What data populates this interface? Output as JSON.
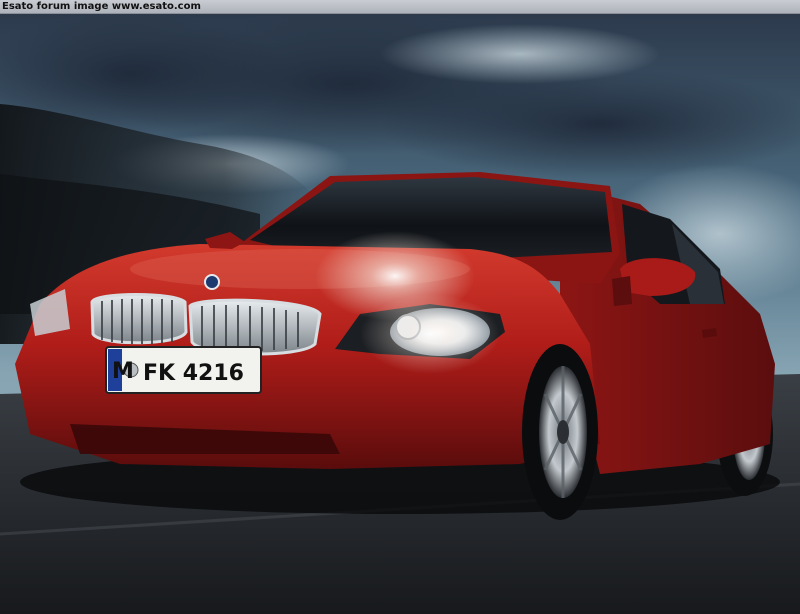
{
  "watermark": {
    "text": "Esato forum image www.esato.com"
  },
  "photo": {
    "subject": "red-coupe-car",
    "license_plate": {
      "prefix": "M",
      "number": "FK 4216"
    },
    "colors": {
      "car_body": "#b5201c",
      "sky": "#5f7f92",
      "road": "#2a2d31"
    }
  }
}
